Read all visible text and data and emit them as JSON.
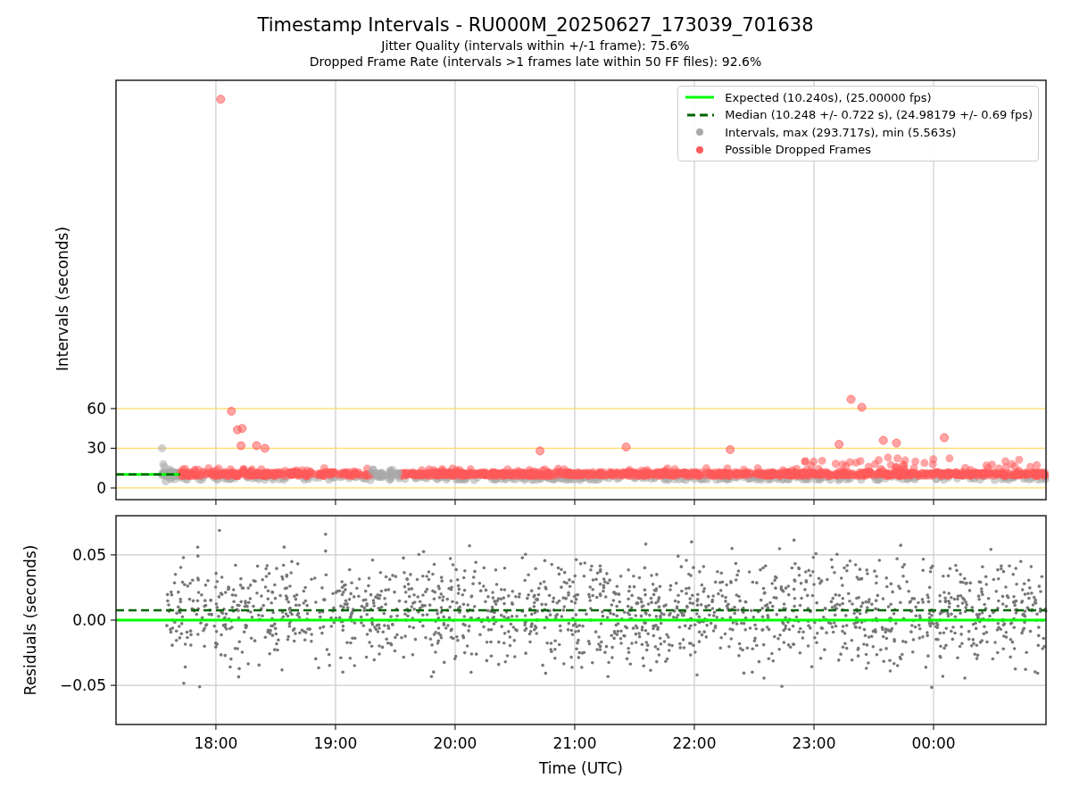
{
  "figure": {
    "title": "Timestamp Intervals - RU000M_20250627_173039_701638",
    "subtitles": [
      "Jitter Quality (intervals within +/-1 frame): 75.6%",
      "Dropped Frame Rate (intervals >1 frames late within 50 FF files): 92.6%"
    ]
  },
  "intervals_panel": {
    "legend": [
      {
        "label": "Expected (10.240s), (25.00000 fps)",
        "kind": "line",
        "color": "#00ff00"
      },
      {
        "label": "Median (10.248 +/- 0.722 s), (24.98179 +/- 0.69 fps)",
        "kind": "dashed",
        "color": "#006400"
      },
      {
        "label": "Intervals, max (293.717s), min (5.563s)",
        "kind": "dot",
        "color": "#aaaaaa"
      },
      {
        "label": "Possible Dropped Frames",
        "kind": "dot",
        "color": "#ff5a5a"
      }
    ],
    "y_axis_label": "Intervals (seconds)",
    "y_tick_labels": [
      "60",
      "30",
      "0"
    ]
  },
  "residuals_panel": {
    "chart_data": {
      "type": "scatter",
      "xlabel": "Time (UTC)",
      "ylabel": "Residuals (seconds)",
      "xlim": [
        17.165,
        24.94
      ],
      "ylim": [
        -0.08,
        0.08
      ],
      "xticks": [
        {
          "value": 18,
          "label": "18:00"
        },
        {
          "value": 19,
          "label": "19:00"
        },
        {
          "value": 20,
          "label": "20:00"
        },
        {
          "value": 21,
          "label": "21:00"
        },
        {
          "value": 22,
          "label": "22:00"
        },
        {
          "value": 23,
          "label": "23:00"
        },
        {
          "value": 24,
          "label": "00:00"
        }
      ],
      "yticks": [
        {
          "value": -0.05,
          "label": "−0.05"
        },
        {
          "value": 0,
          "label": "0.00"
        },
        {
          "value": 0.05,
          "label": "0.05"
        }
      ],
      "grid": true,
      "ref_lines": [
        {
          "axis": "y",
          "value": 0.0075,
          "color": "#006400"
        },
        {
          "axis": "y",
          "value": 0,
          "color": "#00ff00"
        }
      ]
    }
  }
}
